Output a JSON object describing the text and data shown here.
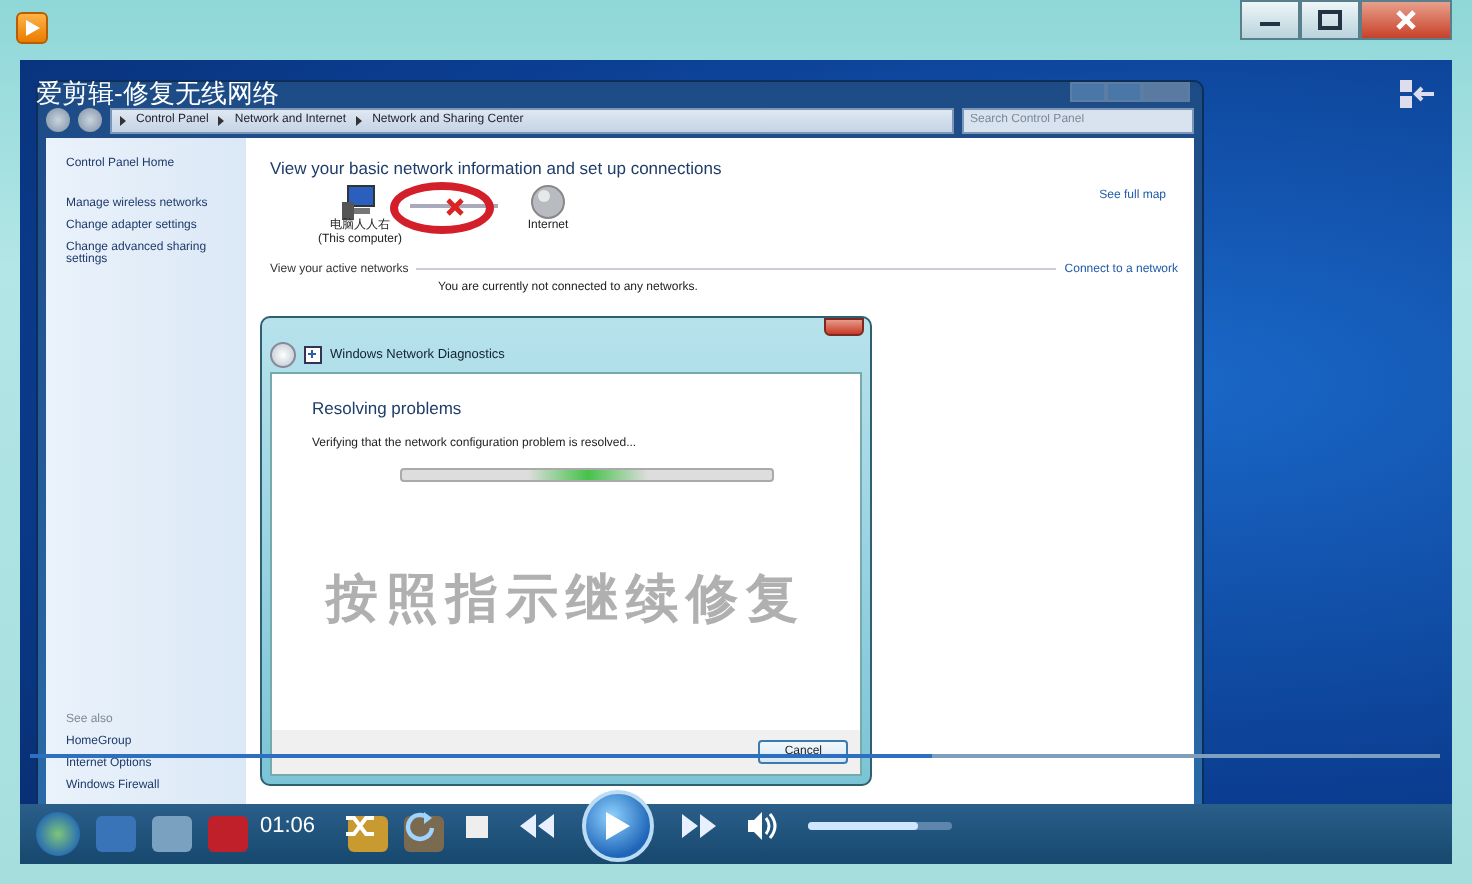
{
  "video_title": "爱剪辑-修复无线网络",
  "control_panel": {
    "breadcrumb": [
      "Control Panel",
      "Network and Internet",
      "Network and Sharing Center"
    ],
    "search": {
      "placeholder": "Search Control Panel"
    },
    "sidebar": {
      "items": [
        "Control Panel Home",
        "Manage wireless networks",
        "Change adapter settings",
        "Change advanced sharing settings"
      ],
      "see_also_label": "See also",
      "see_also": [
        "HomeGroup",
        "Internet Options",
        "Windows Firewall"
      ]
    },
    "heading": "View your basic network information and set up connections",
    "map": [
      {
        "kind": "computer",
        "label": "电脑人人右",
        "sublabel": "(This computer)"
      },
      {
        "kind": "internet",
        "label": "Internet"
      }
    ],
    "link_broken": true,
    "see_full_map": "See full map",
    "active_label": "View your active networks",
    "connect_link": "Connect to a network",
    "status": "You are currently not connected to any networks."
  },
  "dialog": {
    "title": "Windows Network Diagnostics",
    "heading": "Resolving problems",
    "message": "Verifying that the network configuration problem is resolved...",
    "progress": {
      "level": 0.5
    },
    "cancel": "Cancel"
  },
  "video_caption": "按照指示继续修复",
  "player_controls": {
    "time": "01:06",
    "seek": {
      "level": 0.64
    },
    "volume": {
      "level": 0.77
    }
  }
}
